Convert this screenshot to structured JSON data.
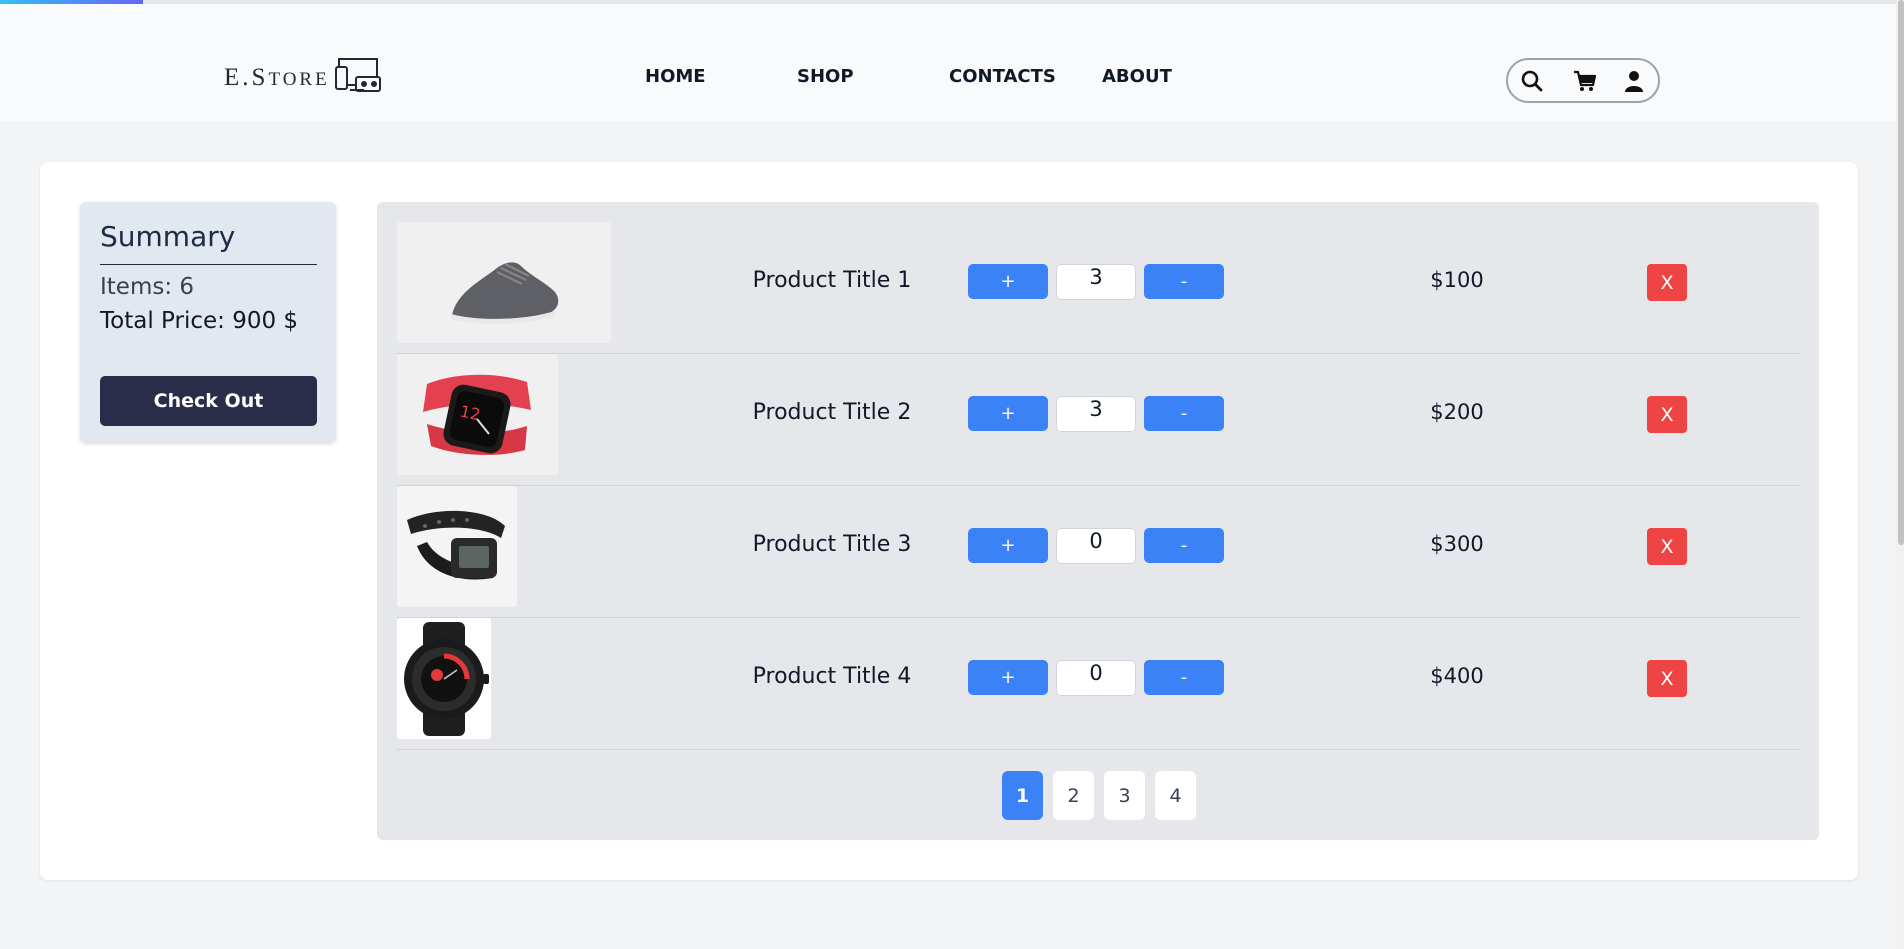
{
  "app": {
    "logo": {
      "text_main": "E.S",
      "text_small": "TORE",
      "icon": "devices-icon"
    }
  },
  "nav": {
    "links": [
      {
        "label": "HOME"
      },
      {
        "label": "SHOP"
      },
      {
        "label": "CONTACTS"
      },
      {
        "label": "ABOUT"
      }
    ],
    "icons": [
      "search-icon",
      "cart-icon",
      "user-icon"
    ]
  },
  "summary": {
    "title": "Summary",
    "items_label": "Items: 6",
    "total_label": "Total Price: 900 $",
    "checkout_label": "Check Out"
  },
  "cart": {
    "items": [
      {
        "title": "Product Title 1",
        "quantity": "3",
        "price": "$100",
        "image": "sneaker-image",
        "plus": "+",
        "minus": "-",
        "remove": "X"
      },
      {
        "title": "Product Title 2",
        "quantity": "3",
        "price": "$200",
        "image": "red-smartwatch-image",
        "plus": "+",
        "minus": "-",
        "remove": "X"
      },
      {
        "title": "Product Title 3",
        "quantity": "0",
        "price": "$300",
        "image": "black-digital-watch-image",
        "plus": "+",
        "minus": "-",
        "remove": "X"
      },
      {
        "title": "Product Title 4",
        "quantity": "0",
        "price": "$400",
        "image": "black-sport-watch-image",
        "plus": "+",
        "minus": "-",
        "remove": "X"
      }
    ]
  },
  "pagination": {
    "pages": [
      "1",
      "2",
      "3",
      "4"
    ],
    "current": "1"
  },
  "colors": {
    "accent": "#3b82f6",
    "danger": "#ef4444",
    "checkout": "#2a2d4a"
  }
}
